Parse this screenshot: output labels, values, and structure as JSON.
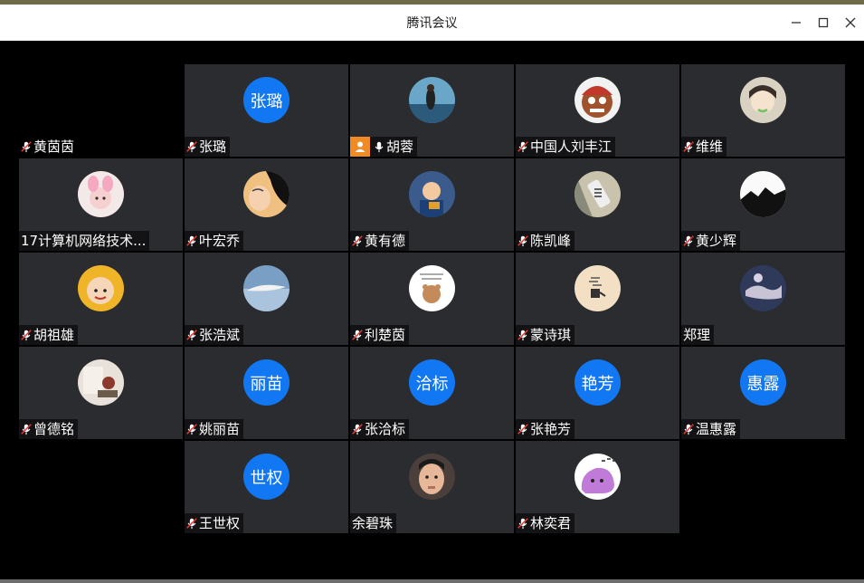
{
  "window": {
    "title": "腾讯会议",
    "controls": [
      "minimize-icon",
      "maximize-icon",
      "close-icon"
    ]
  },
  "participants": [
    {
      "name": "黄茵茵",
      "muted": true
    },
    {
      "name": "张璐",
      "muted": true,
      "avatar_text": "张璐"
    },
    {
      "name": "胡蓉",
      "muted": false,
      "host": true
    },
    {
      "name": "中国人刘丰江",
      "muted": true
    },
    {
      "name": "维维",
      "muted": true
    },
    {
      "name": "17计算机网络技术...",
      "muted": false
    },
    {
      "name": "叶宏乔",
      "muted": true
    },
    {
      "name": "黄有德",
      "muted": true
    },
    {
      "name": "陈凯峰",
      "muted": true
    },
    {
      "name": "黄少辉",
      "muted": true
    },
    {
      "name": "胡祖雄",
      "muted": true
    },
    {
      "name": "张浩斌",
      "muted": true
    },
    {
      "name": "利楚茵",
      "muted": true
    },
    {
      "name": "蒙诗琪",
      "muted": true
    },
    {
      "name": "郑理",
      "muted": false
    },
    {
      "name": "曾德铭",
      "muted": true
    },
    {
      "name": "姚丽苗",
      "muted": true,
      "avatar_text": "丽苗"
    },
    {
      "name": "张洽标",
      "muted": true,
      "avatar_text": "洽标"
    },
    {
      "name": "张艳芳",
      "muted": true,
      "avatar_text": "艳芳"
    },
    {
      "name": "温惠露",
      "muted": true,
      "avatar_text": "惠露"
    },
    {
      "name": "王世权",
      "muted": true,
      "avatar_text": "世权"
    },
    {
      "name": "余碧珠",
      "muted": false
    },
    {
      "name": "林奕君",
      "muted": true
    }
  ],
  "colors": {
    "tile_bg": "#2b2c2f",
    "avatar_blue": "#1277f3",
    "host_badge": "#f08a24",
    "mute_red": "#e53935"
  }
}
